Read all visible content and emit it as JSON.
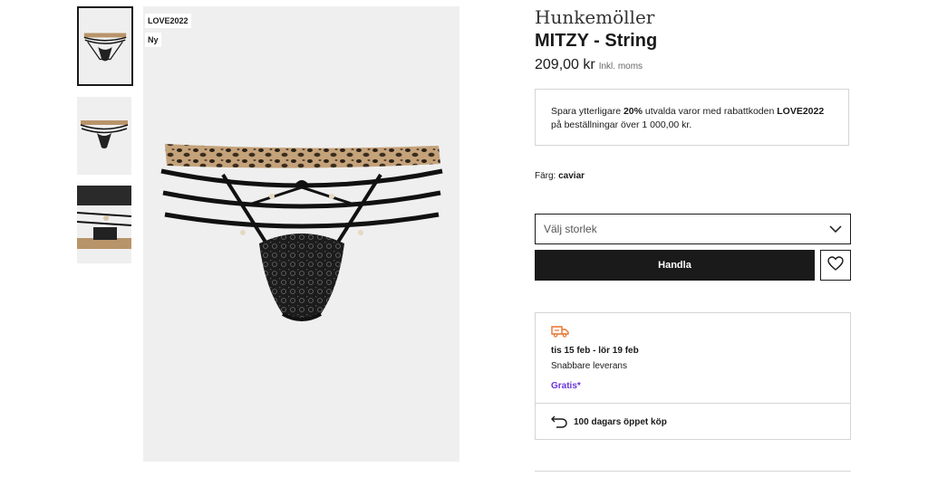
{
  "gallery": {
    "thumbnails": [
      {
        "name": "thumbnail-1",
        "active": true
      },
      {
        "name": "thumbnail-2",
        "active": false
      },
      {
        "name": "thumbnail-3",
        "active": false
      }
    ],
    "flags": [
      "LOVE2022",
      "Ny"
    ]
  },
  "product": {
    "brand": "Hunkemöller",
    "name": "MITZY - String",
    "price": "209,00 kr",
    "price_note": "Inkl. moms"
  },
  "promo": {
    "text_before": "Spara ytterligare ",
    "discount": "20%",
    "text_middle": " utvalda varor med rabattkoden ",
    "code": "LOVE2022",
    "text_after": "på beställningar över 1 000,00 kr."
  },
  "color": {
    "label": "Färg:",
    "value": "caviar"
  },
  "size_select": {
    "placeholder": "Välj storlek",
    "icon": "chevron-down-icon"
  },
  "buy_button": {
    "label": "Handla"
  },
  "wishlist": {
    "icon": "heart-icon"
  },
  "delivery": {
    "icon": "truck-icon",
    "dates": "tis 15 feb - lör 19 feb",
    "speed": "Snabbare leverans",
    "cost": "Gratis*",
    "return_icon": "return-arrow-icon",
    "return_text": "100 dagars öppet köp"
  },
  "colors": {
    "accent_purple": "#6b35d6",
    "truck_orange": "#e8742c",
    "button_black": "#1a1a1a"
  }
}
